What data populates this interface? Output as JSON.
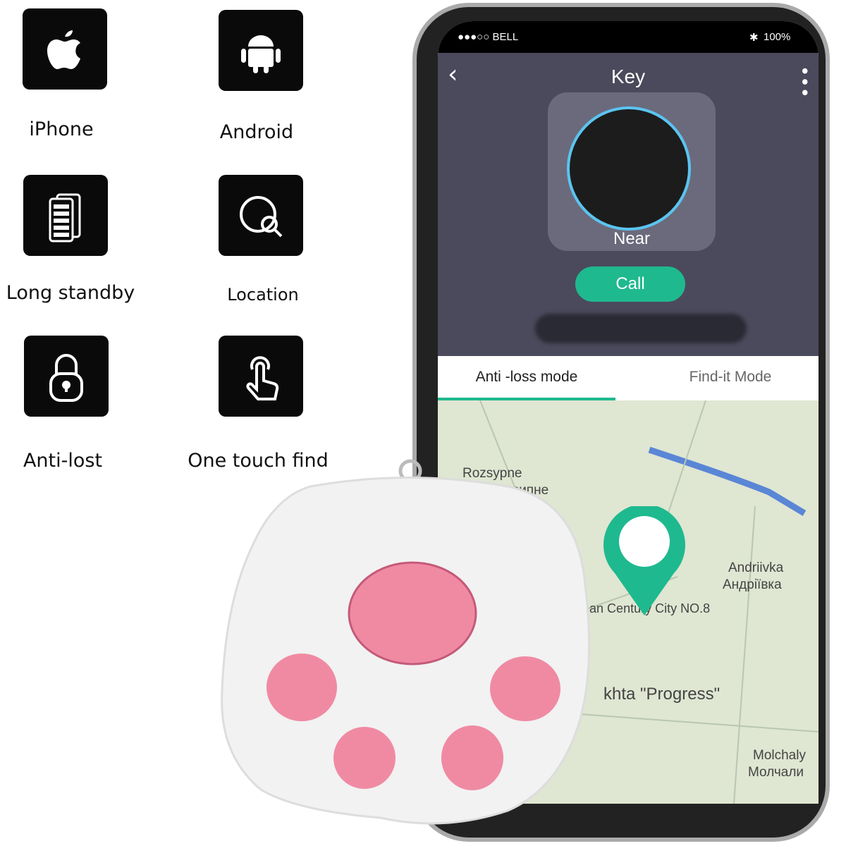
{
  "features": [
    {
      "label": "iPhone",
      "icon": "apple-icon"
    },
    {
      "label": "Android",
      "icon": "android-icon"
    },
    {
      "label": "Long standby",
      "icon": "battery-icon"
    },
    {
      "label": "Location",
      "icon": "location-search-icon"
    },
    {
      "label": "Anti-lost",
      "icon": "padlock-icon"
    },
    {
      "label": "One touch find",
      "icon": "touch-hand-icon"
    }
  ],
  "phone": {
    "status": {
      "carrier": "●●●○○ BELL",
      "battery": "100%"
    },
    "title": "Key",
    "device_status": "Near",
    "call_label": "Call",
    "tabs": [
      {
        "label": "Anti -loss mode",
        "active": true
      },
      {
        "label": "Find-it Mode",
        "active": false
      }
    ],
    "map_labels": [
      "Rozsypne",
      "Розсипне",
      "Andriivka",
      "Андріївка",
      "ngnan Century City NO.8",
      "khta \"Progress\"",
      "Molchaly",
      "Молчали"
    ]
  },
  "colors": {
    "accent": "#1fb98f",
    "header": "#4b4a5c",
    "paw_pad": "#f08aa3"
  }
}
